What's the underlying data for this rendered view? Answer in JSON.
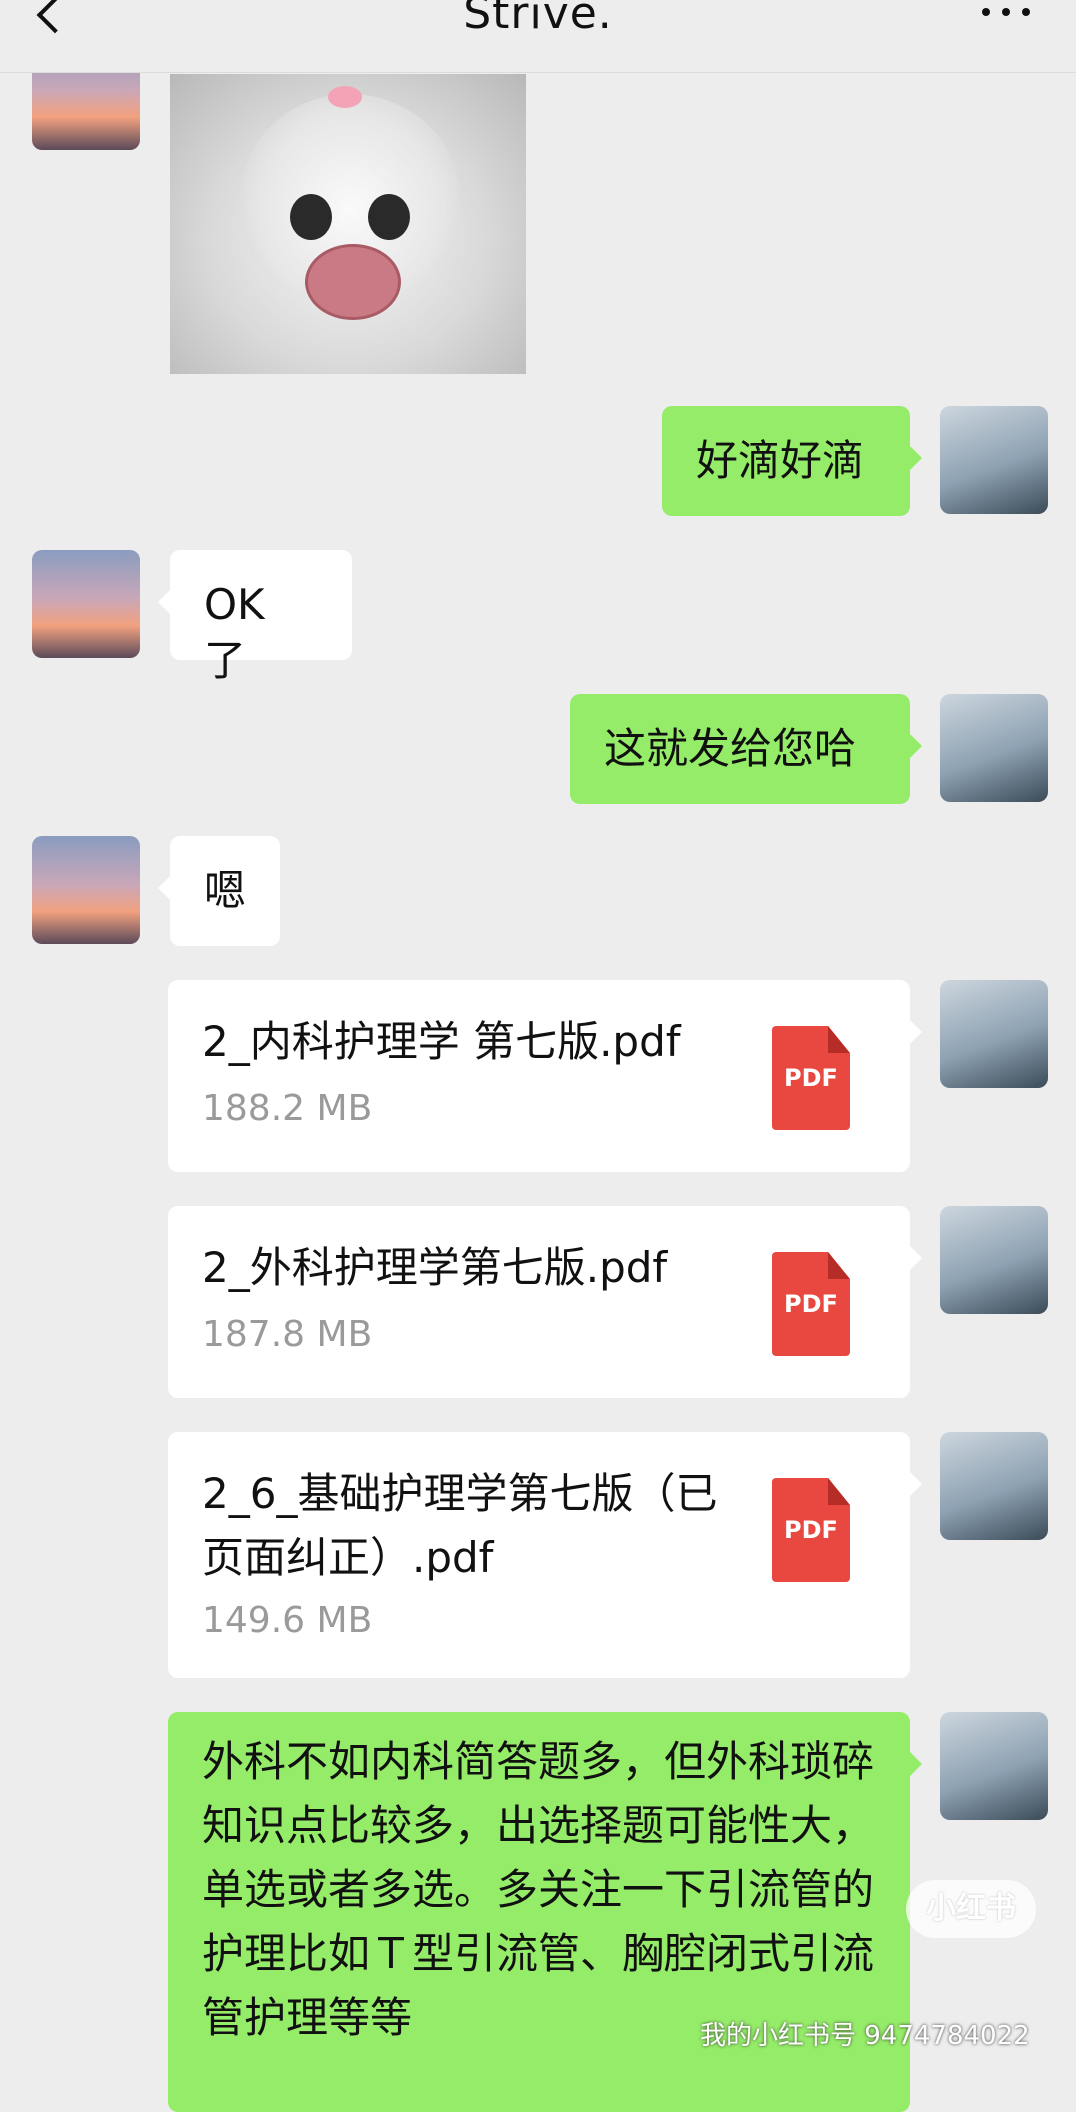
{
  "header": {
    "title": "Strive."
  },
  "messages": {
    "m1": {
      "text": "好滴好滴"
    },
    "m2": {
      "text": "OK 了"
    },
    "m3": {
      "text": "这就发给您哈"
    },
    "m4": {
      "text": "嗯"
    },
    "m5": {
      "text": "外科不如内科简答题多，但外科琐碎知识点比较多，出选择题可能性大，单选或者多选。多关注一下引流管的护理比如Ｔ型引流管、胸腔闭式引流管护理等等"
    }
  },
  "files": [
    {
      "name": "2_内科护理学  第七版.pdf",
      "size": "188.2 MB",
      "icon_label": "PDF"
    },
    {
      "name": "2_外科护理学第七版.pdf",
      "size": "187.8 MB",
      "icon_label": "PDF"
    },
    {
      "name": "2_6_基础护理学第七版（已页面纠正）.pdf",
      "size": "149.6 MB",
      "icon_label": "PDF"
    }
  ],
  "watermark": {
    "logo": "小红书",
    "text": "我的小红书号 9474784022"
  },
  "icons": {
    "back": "chevron-left-icon",
    "more": "more-dots-icon",
    "file": "pdf-file-icon"
  },
  "colors": {
    "background": "#ededed",
    "sent_bubble": "#95ec69",
    "received_bubble": "#ffffff",
    "pdf_red": "#e8483f"
  }
}
